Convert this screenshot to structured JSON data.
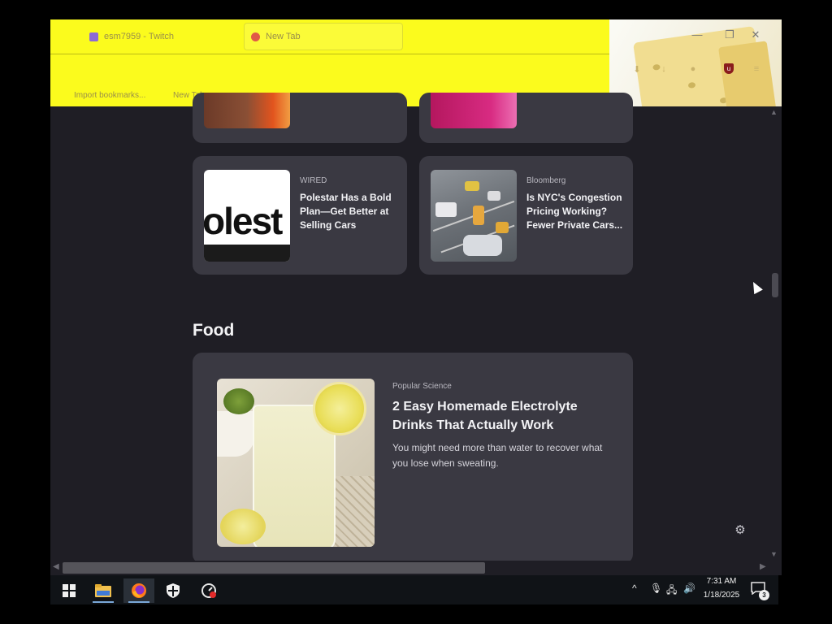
{
  "browser": {
    "tabs": [
      {
        "label": "esm7959 - Twitch",
        "active": false
      },
      {
        "label": "New Tab",
        "active": true
      }
    ],
    "bookmarks": [
      {
        "label": "Import bookmarks..."
      },
      {
        "label": "New Tab"
      }
    ],
    "window_controls": {
      "minimize": "—",
      "maximize": "❐",
      "close": "✕"
    }
  },
  "stories": [
    {
      "source": "WIRED",
      "headline": "Polestar Has a Bold Plan—Get Better at Selling Cars",
      "thumbnail_text": "olest"
    },
    {
      "source": "Bloomberg",
      "headline": "Is NYC's Congestion Pricing Working? Fewer Private Cars..."
    }
  ],
  "sections": [
    {
      "title": "Food",
      "featured": {
        "source": "Popular Science",
        "headline": "2 Easy Homemade Electrolyte Drinks That Actually Work",
        "description": "You might need more than water to recover what you lose when sweating."
      }
    }
  ],
  "page_controls": {
    "settings_icon": "gear-icon"
  },
  "taskbar": {
    "apps": [
      {
        "name": "start-button",
        "icon": "windows-logo-icon"
      },
      {
        "name": "file-explorer",
        "icon": "folder-icon"
      },
      {
        "name": "firefox",
        "icon": "firefox-icon"
      },
      {
        "name": "windows-security",
        "icon": "shield-icon"
      },
      {
        "name": "app",
        "icon": "gauge-icon"
      }
    ],
    "tray": {
      "time": "7:31 AM",
      "date": "1/18/2025",
      "notification_count": "3"
    }
  },
  "colors": {
    "tab_bar": "#fbfb1d",
    "page_background": "#1f1e25",
    "card_background": "#3a3942",
    "taskbar": "#101317"
  }
}
